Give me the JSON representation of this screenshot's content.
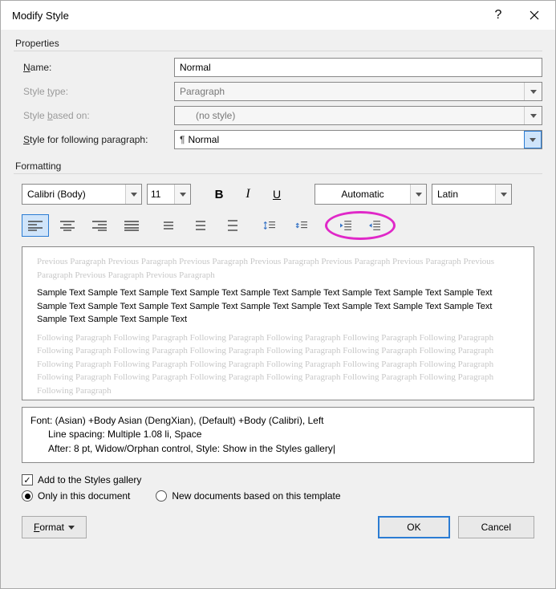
{
  "title": "Modify Style",
  "section_properties": "Properties",
  "labels": {
    "name": "Name:",
    "style_type": "Style type:",
    "style_based": "Style based on:",
    "following": "Style for following paragraph:"
  },
  "values": {
    "name": "Normal",
    "style_type": "Paragraph",
    "style_based": "(no style)",
    "following": "Normal"
  },
  "section_formatting": "Formatting",
  "font": {
    "name": "Calibri (Body)",
    "size": "11",
    "color": "Automatic",
    "script": "Latin"
  },
  "preview": {
    "ghost_prev": "Previous Paragraph Previous Paragraph Previous Paragraph Previous Paragraph Previous Paragraph Previous Paragraph Previous Paragraph Previous Paragraph Previous Paragraph",
    "sample": "Sample Text Sample Text Sample Text Sample Text Sample Text Sample Text Sample Text Sample Text Sample Text Sample Text Sample Text Sample Text Sample Text Sample Text Sample Text Sample Text Sample Text Sample Text Sample Text Sample Text Sample Text",
    "ghost_next": "Following Paragraph Following Paragraph Following Paragraph Following Paragraph Following Paragraph Following Paragraph Following Paragraph Following Paragraph Following Paragraph Following Paragraph Following Paragraph Following Paragraph Following Paragraph Following Paragraph Following Paragraph Following Paragraph Following Paragraph Following Paragraph Following Paragraph Following Paragraph Following Paragraph Following Paragraph Following Paragraph Following Paragraph Following Paragraph"
  },
  "description": {
    "line1": "Font: (Asian) +Body Asian (DengXian), (Default) +Body (Calibri), Left",
    "line2": "Line spacing:  Multiple 1.08 li, Space",
    "line3": "After:  8 pt, Widow/Orphan control, Style: Show in the Styles gallery"
  },
  "options": {
    "add_gallery": "Add to the Styles gallery",
    "only_doc": "Only in this document",
    "new_docs": "New documents based on this template"
  },
  "buttons": {
    "format": "Format",
    "ok": "OK",
    "cancel": "Cancel"
  }
}
